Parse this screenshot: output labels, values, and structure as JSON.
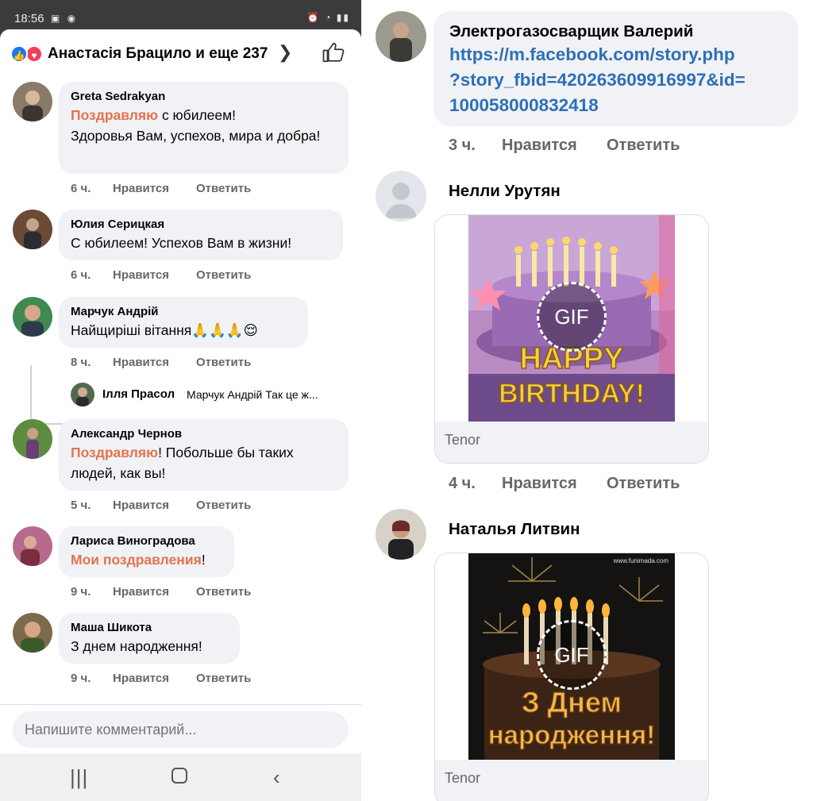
{
  "status_bar": {
    "time": "18:56"
  },
  "reactions": {
    "summary": "Анастасія Брацило и еще 237"
  },
  "comments": [
    {
      "author": "Greta Sedrakyan",
      "highlight": "Поздравляю",
      "text_after_highlight": " с юбилеем!",
      "text_more": "Здоровья Вам, успехов, мира и добра!",
      "time": "6 ч.",
      "like_label": "Нравится",
      "reply_label": "Ответить"
    },
    {
      "author": "Юлия Серицкая",
      "text": "С юбилеем! Успехов Вам в жизни!",
      "time": "6 ч.",
      "like_label": "Нравится",
      "reply_label": "Ответить"
    },
    {
      "author": "Марчук Андрій",
      "text": "Найщиріші вітання🙏🙏🙏😌",
      "time": "8 ч.",
      "like_label": "Нравится",
      "reply_label": "Ответить",
      "reply_preview": {
        "author": "Ілля Прасол",
        "text": "Марчук Андрій Так це ж..."
      }
    },
    {
      "author": "Александр Чернов",
      "highlight": "Поздравляю",
      "text_after_highlight": "! Побольше бы таких",
      "text_more": "людей, как вы!",
      "time": "5 ч.",
      "like_label": "Нравится",
      "reply_label": "Ответить"
    },
    {
      "author": "Лариса Виноградова",
      "highlight": "Мои поздравления",
      "text_after_highlight": "!",
      "time": "9 ч.",
      "like_label": "Нравится",
      "reply_label": "Ответить"
    },
    {
      "author": "Маша Шикота",
      "text": "З днем народження!",
      "time": "9 ч.",
      "like_label": "Нравится",
      "reply_label": "Ответить"
    }
  ],
  "composer": {
    "placeholder": "Напишите комментарий..."
  },
  "right_comments": [
    {
      "author": "Электрогазосварщик Валерий",
      "link_lines": [
        "https://m.facebook.com/story.php",
        "?story_fbid=420263609916997&id=",
        "100058000832418"
      ],
      "time": "3 ч.",
      "like_label": "Нравится",
      "reply_label": "Ответить"
    },
    {
      "author": "Нелли Урутян",
      "gif_badge": "GIF",
      "gif_text_1": "HAPPY",
      "gif_text_2": "BIRTHDAY!",
      "gif_source": "Tenor",
      "time": "4 ч.",
      "like_label": "Нравится",
      "reply_label": "Ответить"
    },
    {
      "author": "Наталья Литвин",
      "gif_badge": "GIF",
      "gif_watermark": "www.funimada.com",
      "gif_text_1": "З Днем",
      "gif_text_2": "народження!",
      "gif_source": "Tenor"
    }
  ],
  "colors": {
    "highlight": "#e4734f",
    "link": "#2f6fb6",
    "bubble": "#f0f2f5",
    "like_blue": "#1877f2",
    "love_red": "#f33e58"
  }
}
